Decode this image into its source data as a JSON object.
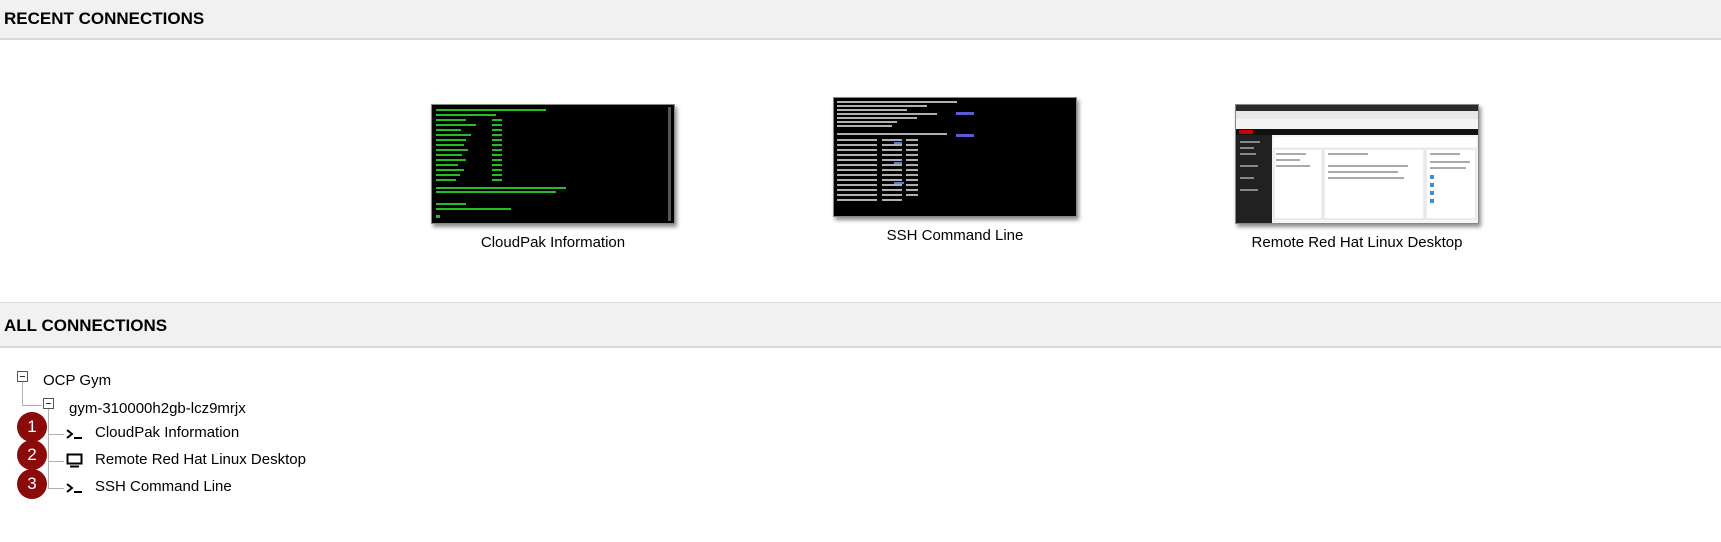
{
  "recent": {
    "title": "RECENT CONNECTIONS",
    "items": [
      {
        "label": "CloudPak Information",
        "thumb": "terminal-green-text"
      },
      {
        "label": "SSH Command Line",
        "thumb": "terminal-white-text"
      },
      {
        "label": "Remote Red Hat Linux Desktop",
        "thumb": "desktop-web-console"
      }
    ]
  },
  "all": {
    "title": "ALL CONNECTIONS",
    "group": "OCP Gym",
    "subgroup": "gym-310000h2gb-lcz9mrjx",
    "connections": [
      {
        "label": "CloudPak Information",
        "icon": "terminal-icon",
        "badge": "1"
      },
      {
        "label": "Remote Red Hat Linux Desktop",
        "icon": "monitor-icon",
        "badge": "2"
      },
      {
        "label": "SSH Command Line",
        "icon": "terminal-icon",
        "badge": "3"
      }
    ]
  },
  "colors": {
    "badge": "#8b0a0a",
    "header_bg": "#f1f1f1"
  }
}
